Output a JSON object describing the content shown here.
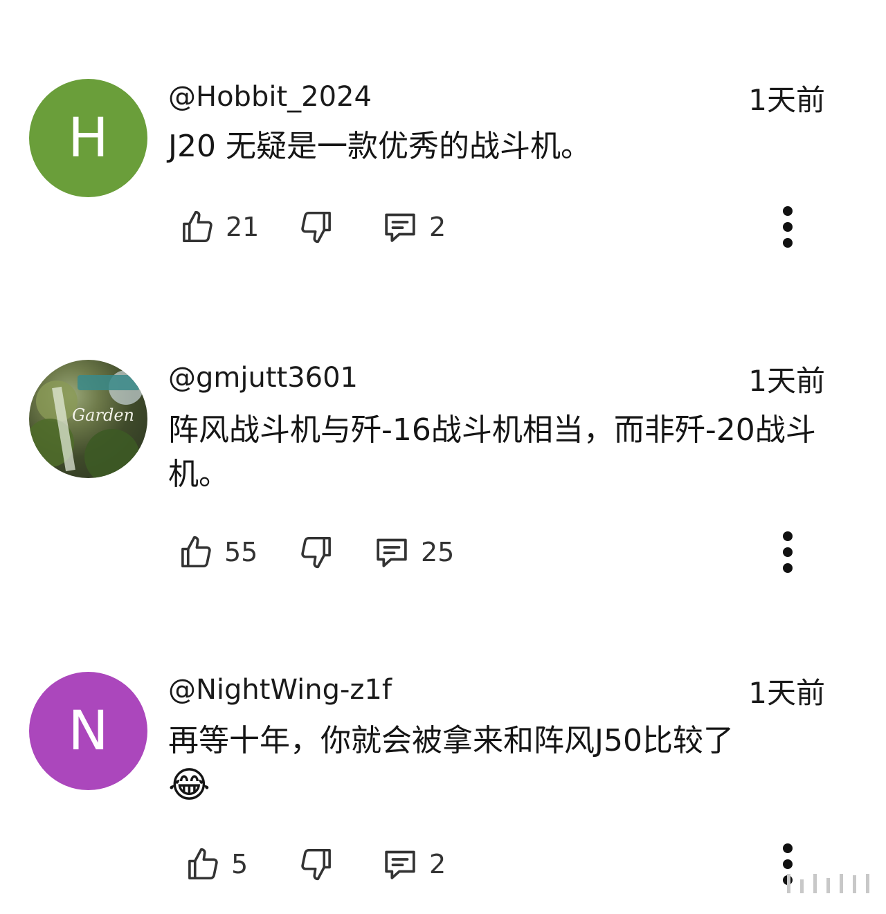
{
  "comments": [
    {
      "avatar_letter": "H",
      "avatar_color": "#6a9e3a",
      "author": "@Hobbit_2024",
      "time": "1天前",
      "text": "J20 无疑是一款优秀的战斗机。",
      "likes": "21",
      "replies": "2"
    },
    {
      "avatar_photo_text": "Garden",
      "author": "@gmjutt3601",
      "time": "1天前",
      "text": "阵风战斗机与歼-16战斗机相当，而非歼-20战斗机。",
      "likes": "55",
      "replies": "25"
    },
    {
      "avatar_letter": "N",
      "avatar_color": "#ab47bc",
      "author": "@NightWing-z1f",
      "time": "1天前",
      "text": "再等十年，你就会被拿来和阵风J50比较了",
      "emoji": "😂",
      "likes": "5",
      "replies": "2"
    }
  ],
  "icons": {
    "like": "thumbs-up-icon",
    "dislike": "thumbs-down-icon",
    "reply": "comment-icon",
    "more": "more-vertical-icon"
  }
}
